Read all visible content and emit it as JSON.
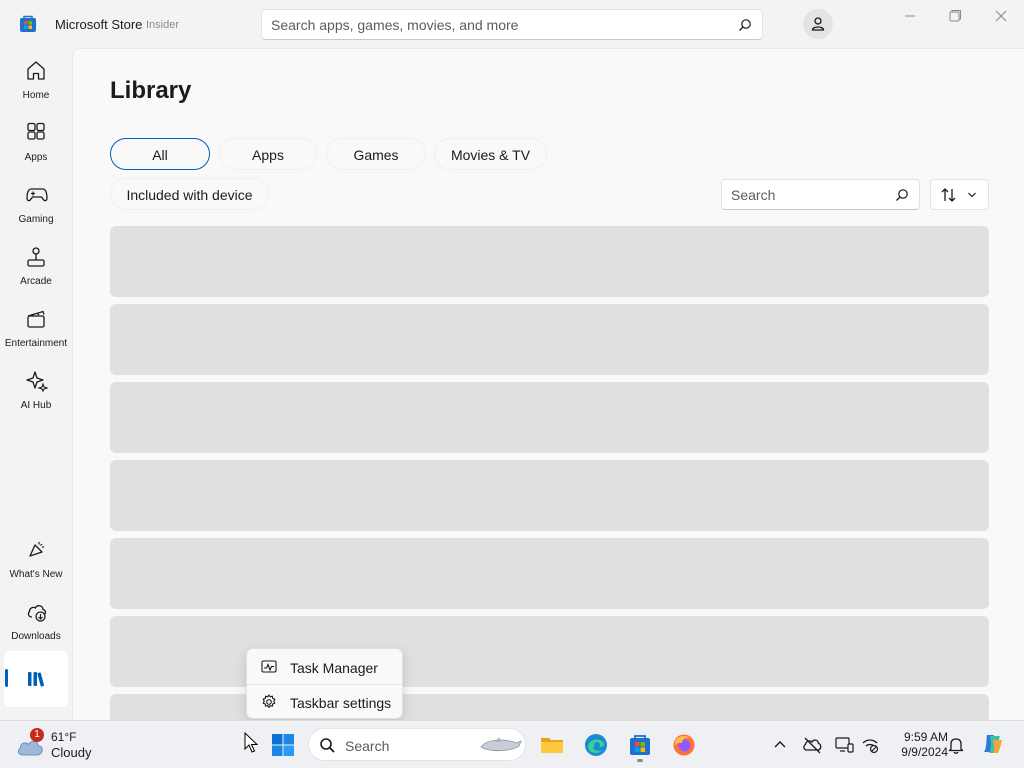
{
  "window": {
    "title": "Microsoft Store",
    "badge": "Insider",
    "search_placeholder": "Search apps, games, movies, and more"
  },
  "sidebar": {
    "items": [
      {
        "label": "Home",
        "icon": "home-icon"
      },
      {
        "label": "Apps",
        "icon": "apps-icon"
      },
      {
        "label": "Gaming",
        "icon": "gamepad-icon"
      },
      {
        "label": "Arcade",
        "icon": "joystick-icon"
      },
      {
        "label": "Entertainment",
        "icon": "clapperboard-icon"
      },
      {
        "label": "AI Hub",
        "icon": "sparkle-icon"
      }
    ],
    "bottom_items": [
      {
        "label": "What's New",
        "icon": "megaphone-icon"
      },
      {
        "label": "Downloads",
        "icon": "cloud-download-icon"
      },
      {
        "label": "",
        "icon": "library-icon",
        "active": true
      }
    ]
  },
  "library": {
    "title": "Library",
    "filters": [
      "All",
      "Apps",
      "Games",
      "Movies & TV",
      "Included with device"
    ],
    "selected_filter": "All",
    "search_placeholder": "Search",
    "sort_icon": "sort-arrows-icon"
  },
  "context_menu": {
    "items": [
      {
        "label": "Task Manager",
        "icon": "task-manager-icon"
      },
      {
        "label": "Taskbar settings",
        "icon": "gear-icon"
      }
    ]
  },
  "taskbar": {
    "weather": {
      "temp": "61°F",
      "condition": "Cloudy",
      "badge": "1"
    },
    "search_label": "Search",
    "time": "9:59 AM",
    "date": "9/9/2024",
    "apps": [
      "start-icon",
      "search-icon",
      "file-explorer-icon",
      "edge-icon",
      "store-icon",
      "firefox-icon"
    ],
    "tray": [
      "chevron-up-icon",
      "onedrive-icon",
      "display-icon",
      "network-icon",
      "bell-icon",
      "copilot-icon"
    ]
  },
  "colors": {
    "accent": "#005fb8",
    "placeholder_row": "#e0e0e0",
    "background": "#f3f3f3"
  }
}
